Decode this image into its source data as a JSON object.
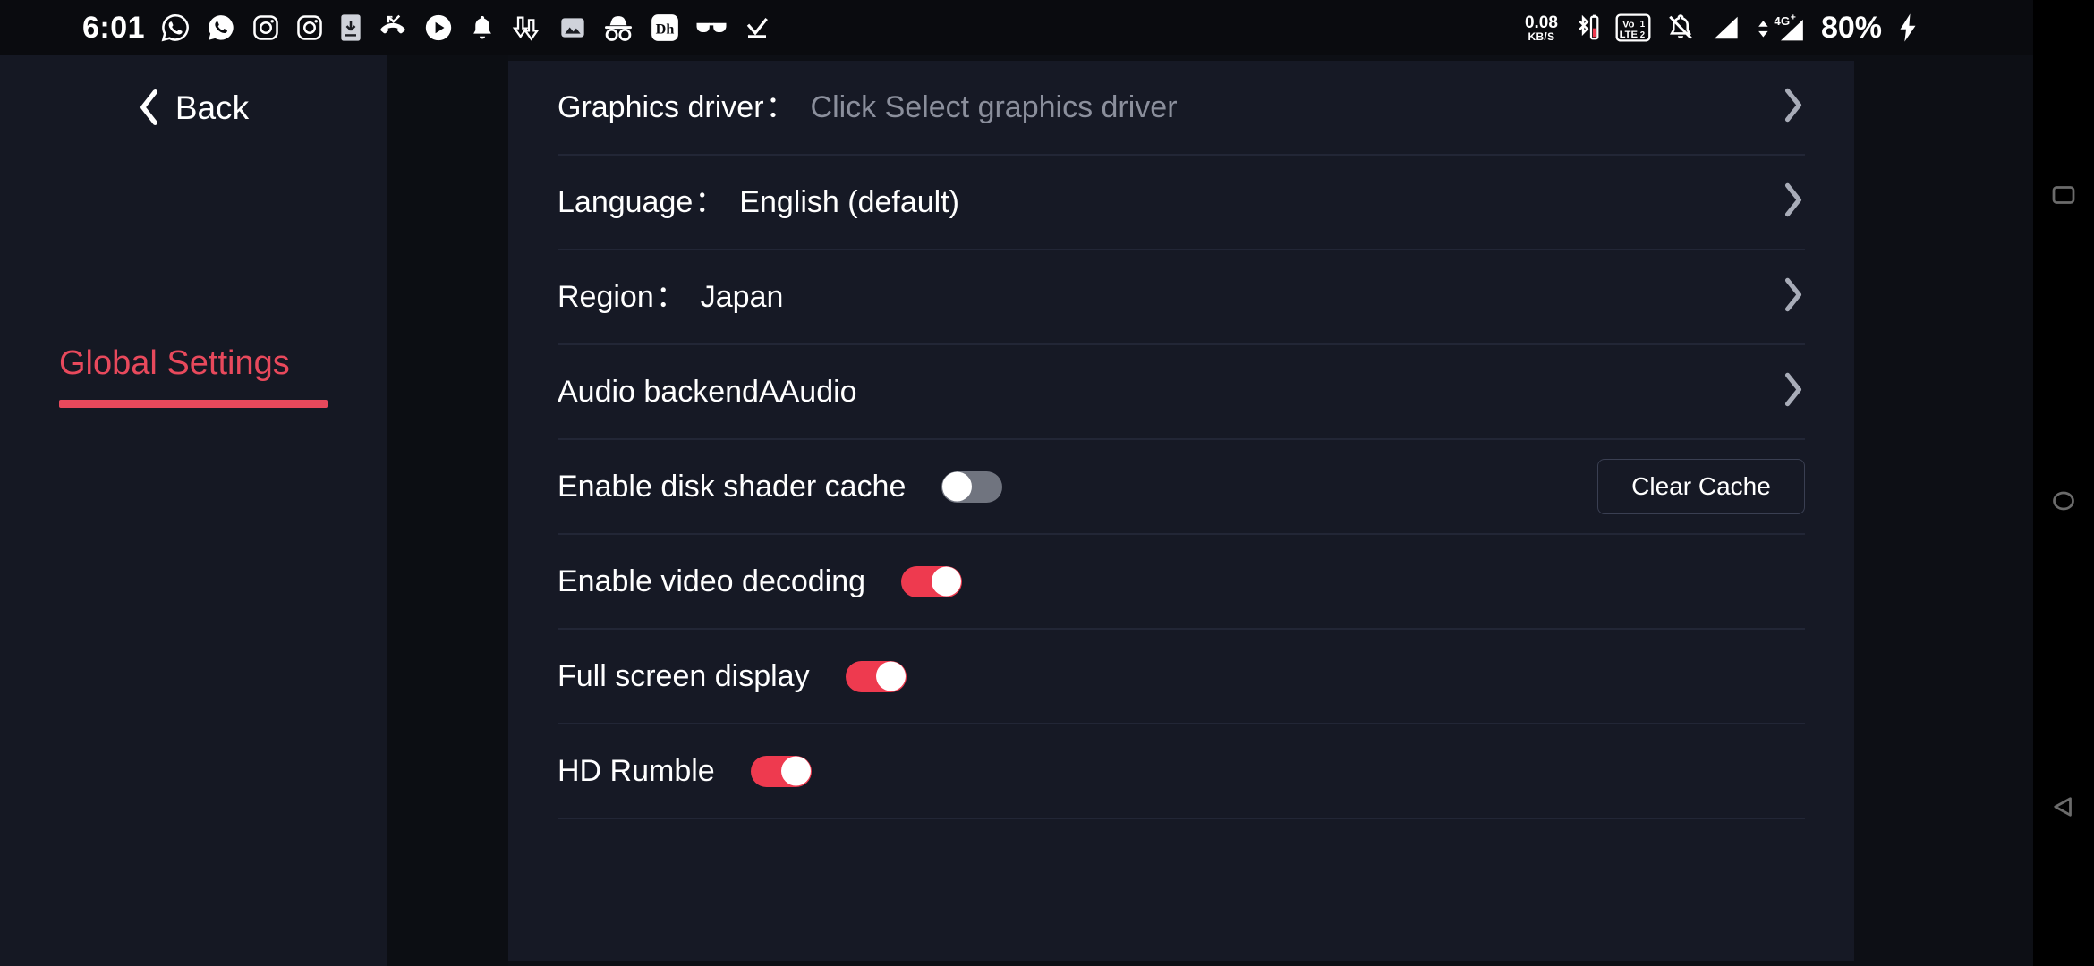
{
  "status_bar": {
    "time": "6:01",
    "battery": "80%",
    "network_speed_value": "0.08",
    "network_speed_unit": "KB/S",
    "left_icons": [
      "whatsapp-icon",
      "whatsapp-business-icon",
      "instagram-icon",
      "instagram-secondary-icon",
      "phone-download-icon",
      "missed-call-icon",
      "play-icon",
      "notification-bell-icon",
      "downloads-arrow-icon",
      "image-icon",
      "incognito-icon",
      "disney-hotstar-icon",
      "glasses-icon",
      "checkmark-icon"
    ],
    "right_icons": [
      "bluetooth-battery-icon",
      "volte-sim-icon",
      "mute-bell-icon",
      "signal-sim1-icon",
      "signal-4g-sim2-icon",
      "charging-bolt-icon"
    ],
    "signal_label": "4G+"
  },
  "sidebar": {
    "back_label": "Back",
    "tab_label": "Global Settings",
    "accent_color": "#e8495c"
  },
  "settings": {
    "rows": [
      {
        "type": "nav",
        "label": "Graphics driver",
        "colon": "：",
        "value": "Click Select graphics driver",
        "is_placeholder": true
      },
      {
        "type": "nav",
        "label": "Language",
        "colon": "：",
        "value": "English (default)",
        "is_placeholder": false
      },
      {
        "type": "nav",
        "label": "Region",
        "colon": "：",
        "value": "Japan",
        "is_placeholder": false
      },
      {
        "type": "nav",
        "label": "Audio backendAAudio",
        "colon": "",
        "value": "",
        "is_placeholder": false
      },
      {
        "type": "toggle-with-button",
        "label": "Enable disk shader cache",
        "toggle_state": "off",
        "button_label": "Clear Cache"
      },
      {
        "type": "toggle",
        "label": "Enable video decoding",
        "toggle_state": "on"
      },
      {
        "type": "toggle",
        "label": "Full screen display",
        "toggle_state": "on"
      },
      {
        "type": "toggle",
        "label": "HD Rumble",
        "toggle_state": "on"
      }
    ]
  },
  "nav_bar": {
    "buttons": [
      "recents-square-icon",
      "home-circle-icon",
      "back-triangle-icon"
    ]
  },
  "colors": {
    "accent_red": "#ee3a4f",
    "panel_bg": "#161925",
    "sidebar_bg": "#151823",
    "toggle_off": "#70747f",
    "placeholder_text": "#8b8f9c"
  }
}
